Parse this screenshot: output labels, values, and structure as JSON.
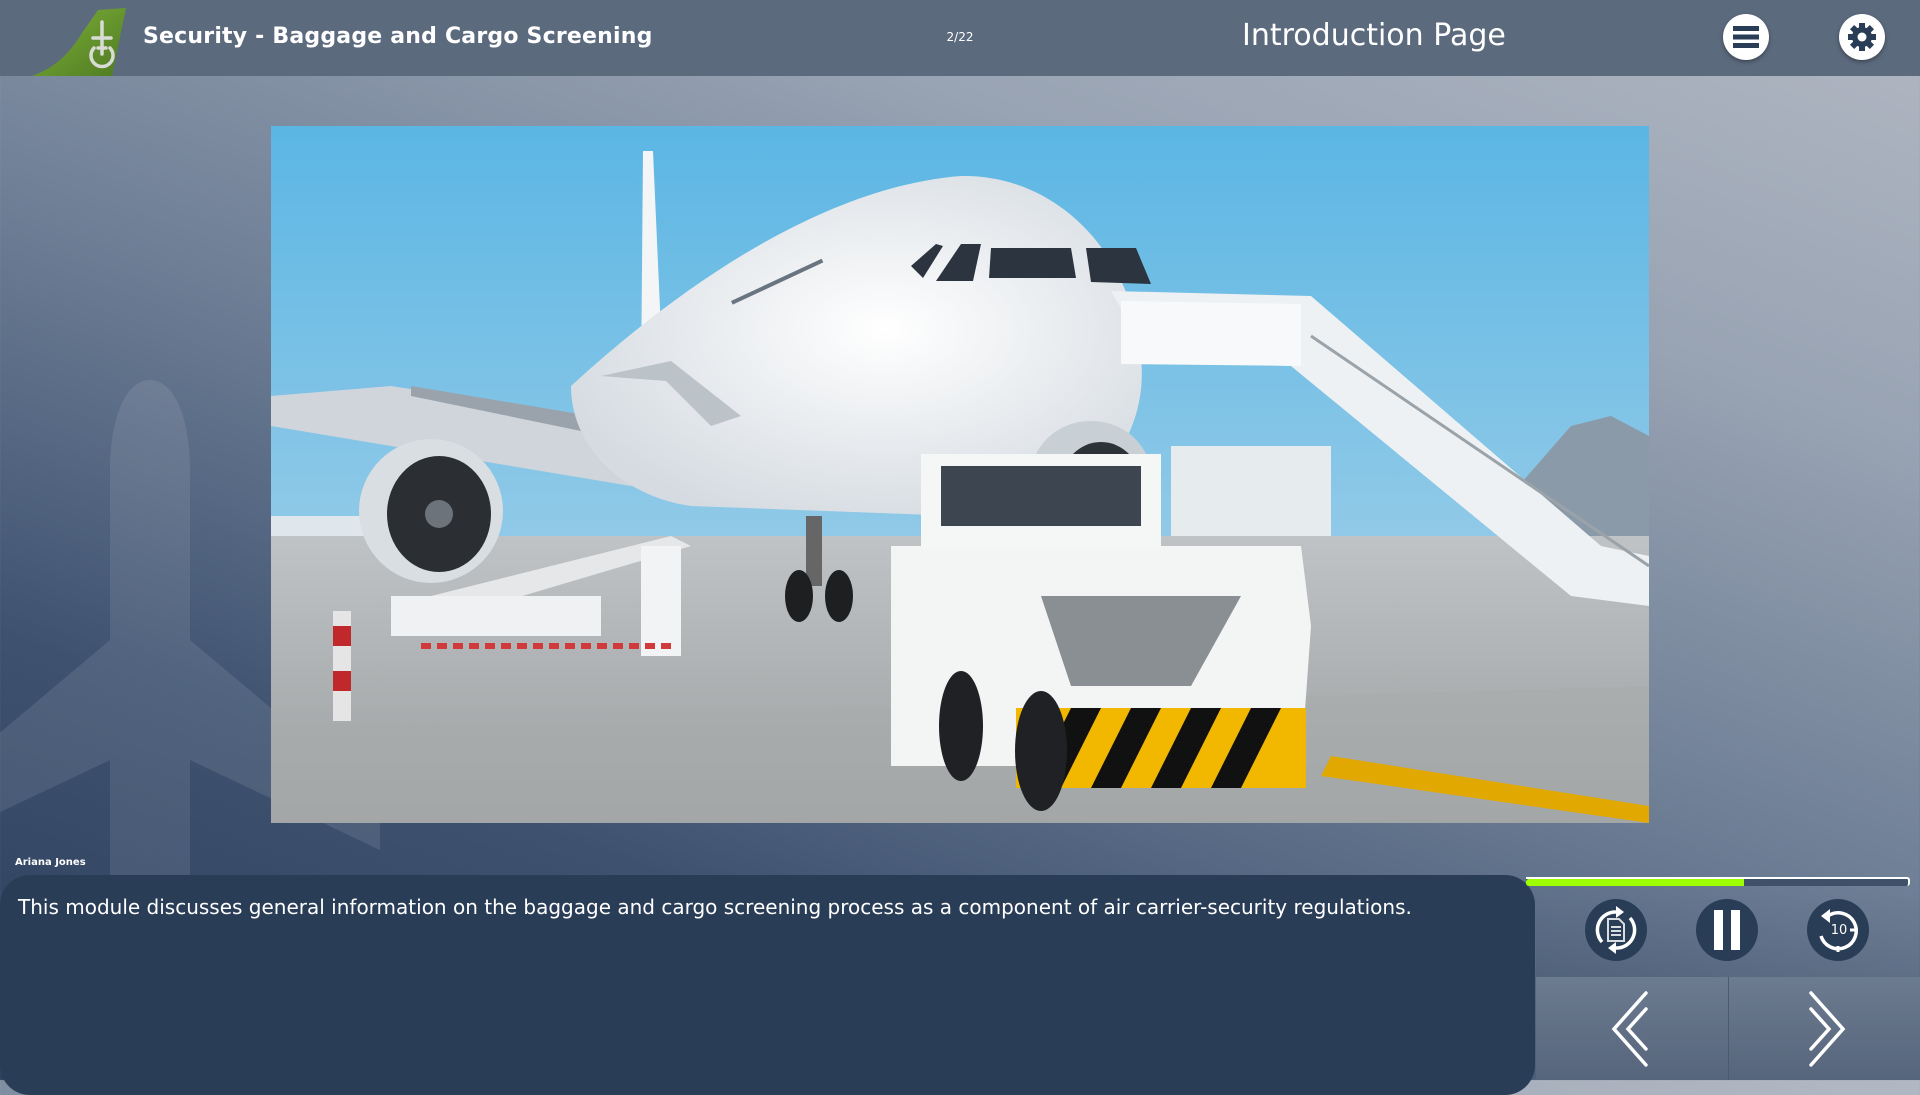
{
  "header": {
    "logo": "airline-tail-logo",
    "course_title": "Security - Baggage and Cargo Screening",
    "page_counter": "2/22",
    "page_title": "Introduction Page",
    "menu_icon": "hamburger-menu-icon",
    "settings_icon": "gear-icon"
  },
  "content": {
    "image_description": "White passenger jet at airport gate with boarding stairs, baggage belt loader and tow tractor on apron under blue sky"
  },
  "narration": {
    "speaker": "Ariana Jones",
    "caption": "This module discusses general information on the baggage and cargo screening process as a component of air carrier-security regulations."
  },
  "player": {
    "progress_percent": 57,
    "progress_fill_color": "#9dff00",
    "controls": [
      {
        "name": "transcript",
        "icon": "transcript-refresh-icon"
      },
      {
        "name": "pause",
        "icon": "pause-icon"
      },
      {
        "name": "replay-10",
        "icon": "replay-10-icon",
        "label": "10"
      }
    ],
    "nav": {
      "back_icon": "double-chevron-left-icon",
      "next_icon": "double-chevron-right-icon"
    }
  },
  "colors": {
    "header_bg": "#5c6a7e",
    "panel_bg": "#2a3d56",
    "logo_green": "#6a9a2c"
  }
}
